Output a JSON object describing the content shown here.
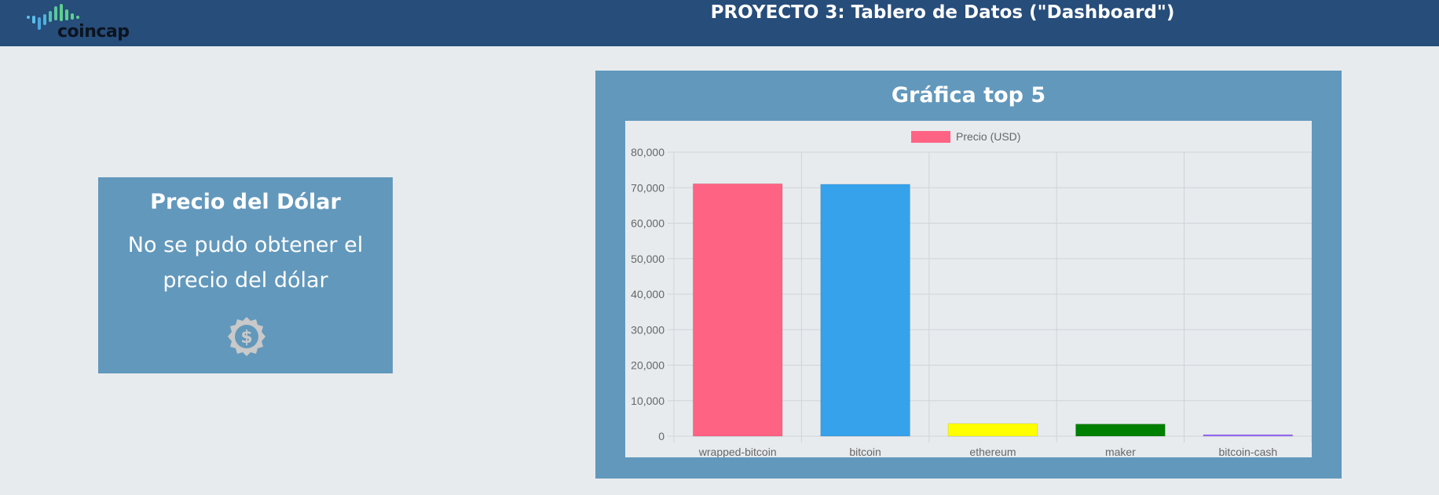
{
  "header": {
    "logo_text": "coincap",
    "title": "PROYECTO 3: Tablero de Datos (\"Dashboard\")"
  },
  "dollar_card": {
    "title": "Precio del Dólar",
    "message": "No se pudo obtener el precio del dólar",
    "icon": "dollar-badge-icon"
  },
  "chart_panel": {
    "title": "Gráfica top 5"
  },
  "chart_data": {
    "type": "bar",
    "categories": [
      "wrapped-bitcoin",
      "bitcoin",
      "ethereum",
      "maker",
      "bitcoin-cash"
    ],
    "series": [
      {
        "name": "Precio (USD)",
        "values": [
          71100,
          70950,
          3550,
          3400,
          420
        ],
        "colors": [
          "#ff6384",
          "#36a2eb",
          "#ffff00",
          "#008000",
          "#9966ff"
        ]
      }
    ],
    "legend_color": "#ff6384",
    "yticks": [
      0,
      10000,
      20000,
      30000,
      40000,
      50000,
      60000,
      70000,
      80000
    ],
    "ytick_labels": [
      "0",
      "10,000",
      "20,000",
      "30,000",
      "40,000",
      "50,000",
      "60,000",
      "70,000",
      "80,000"
    ],
    "ylim": [
      0,
      80000
    ],
    "grid": true,
    "legend_position": "top"
  }
}
